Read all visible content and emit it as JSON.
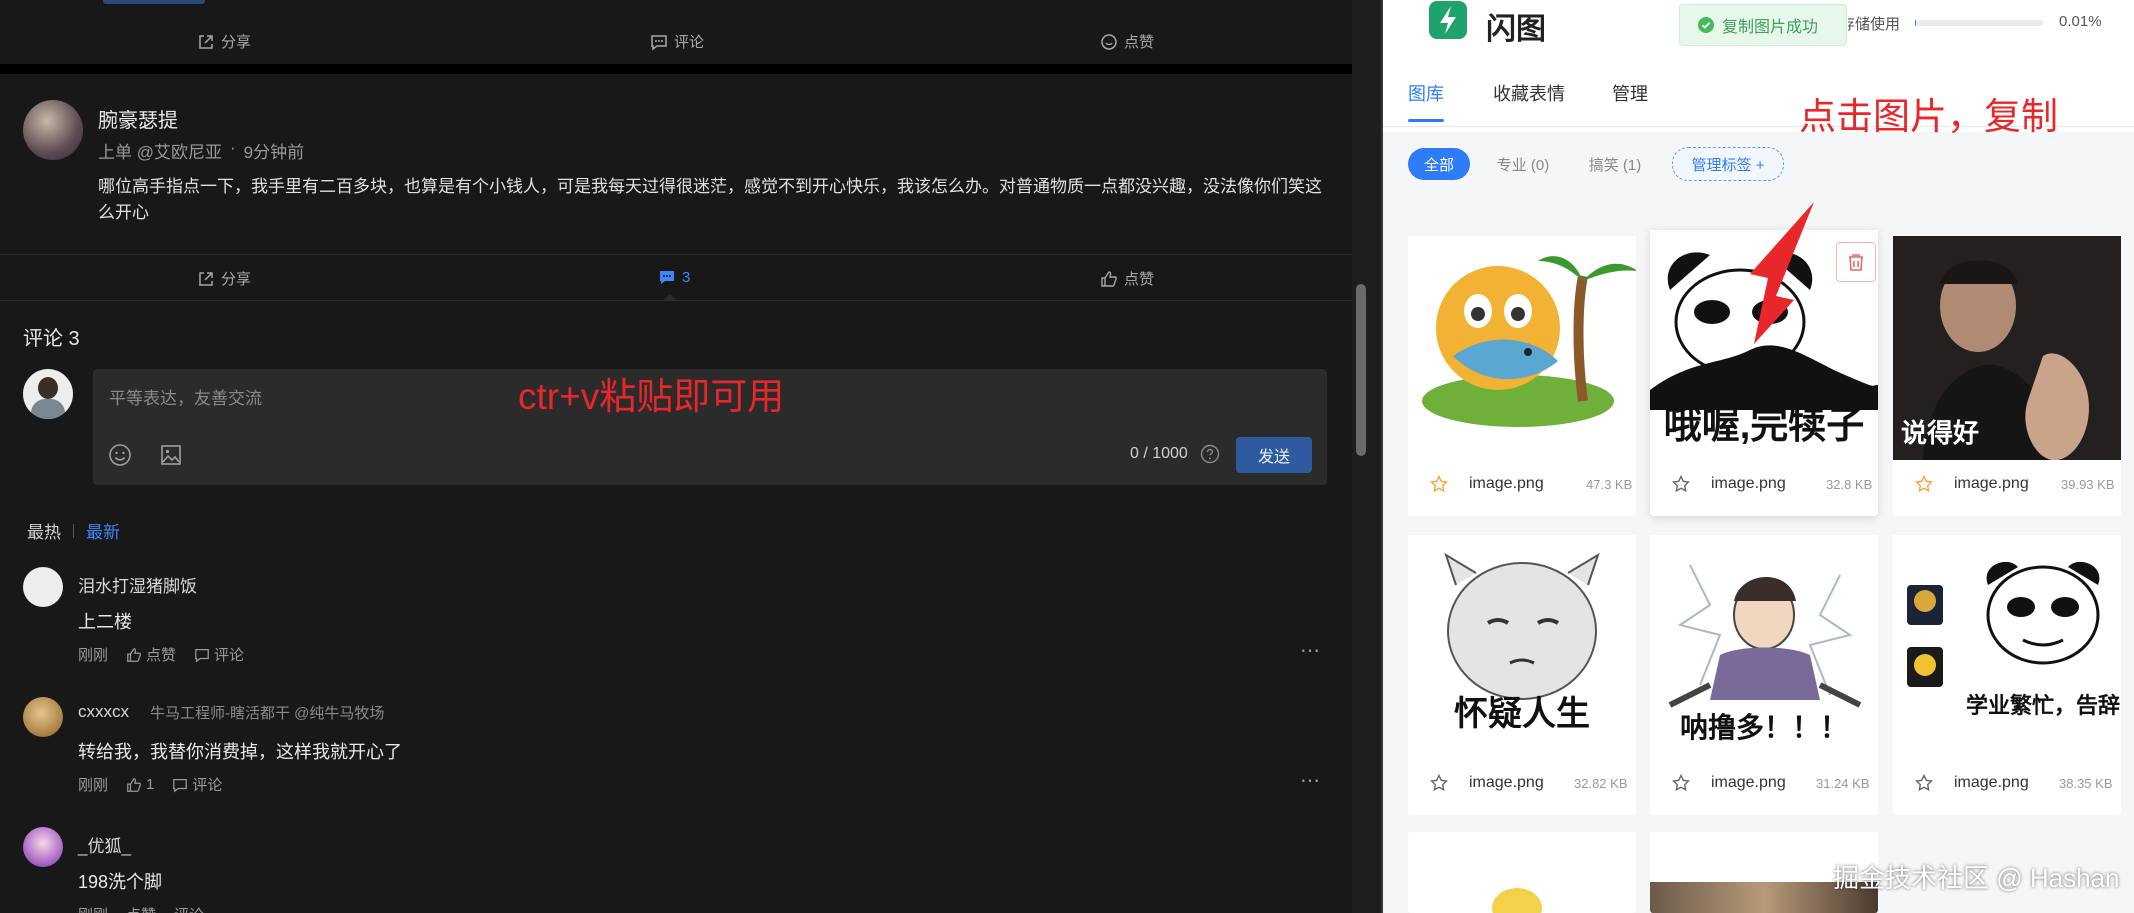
{
  "left": {
    "top_post_actions": {
      "share": "分享",
      "comment": "评论",
      "like": "点赞"
    },
    "post": {
      "author": "腕豪瑟提",
      "meta_tag": "上单 @艾欧尼亚",
      "time": "9分钟前",
      "content": "哪位高手指点一下，我手里有二百多块，也算是有个小钱人，可是我每天过得很迷茫，感觉不到开心快乐，我该怎么办。对普通物质一点都没兴趣，没法像你们笑这么开心",
      "share": "分享",
      "comment_count": "3",
      "like": "点赞"
    },
    "comments_title": "评论 3",
    "comment_box": {
      "placeholder": "平等表达，友善交流",
      "counter": "0 / 1000",
      "send": "发送"
    },
    "annotation_paste": "ctr+v粘贴即可用",
    "sort": {
      "hot": "最热",
      "new": "最新"
    },
    "comments": [
      {
        "name": "泪水打湿猪脚饭",
        "badge": "",
        "text": "上二楼",
        "time": "刚刚",
        "like": "点赞",
        "reply": "评论"
      },
      {
        "name": "cxxxcx",
        "badge": "牛马工程师-瞎活都干 @纯牛马牧场",
        "text": "转给我，我替你消费掉，这样我就开心了",
        "time": "刚刚",
        "like": "1",
        "reply": "评论"
      },
      {
        "name": "_优狐_",
        "badge": "",
        "text": "198洗个脚",
        "time": "刚刚",
        "like": "点赞",
        "reply": "评论"
      }
    ]
  },
  "right": {
    "app_name": "闪图",
    "toast": "复制图片成功",
    "storage_label": "存储使用",
    "storage_value": "0.01%",
    "storage_fraction": 0.0001,
    "tabs": [
      "图库",
      "收藏表情",
      "管理"
    ],
    "annotation_click": "点击图片，复制",
    "filters": {
      "all": "全部",
      "pro": "专业 (0)",
      "fun": "搞笑 (1)",
      "manage": "管理标签 +"
    },
    "images": [
      {
        "name": "image.png",
        "size": "47.3 KB",
        "caption": ""
      },
      {
        "name": "image.png",
        "size": "32.8 KB",
        "caption": "哦喔,完犊子"
      },
      {
        "name": "image.png",
        "size": "39.93 KB",
        "caption": "说得好"
      },
      {
        "name": "image.png",
        "size": "32.82 KB",
        "caption": "怀疑人生"
      },
      {
        "name": "image.png",
        "size": "31.24 KB",
        "caption": "呐撸多！！！"
      },
      {
        "name": "image.png",
        "size": "38.35 KB",
        "caption": "学业繁忙，告辞"
      }
    ],
    "watermark": "掘金技术社区 @ Hashan",
    "colors": {
      "accent": "#2f7df6",
      "annotation": "#e8272a",
      "send_button": "#2e5ba0"
    }
  }
}
